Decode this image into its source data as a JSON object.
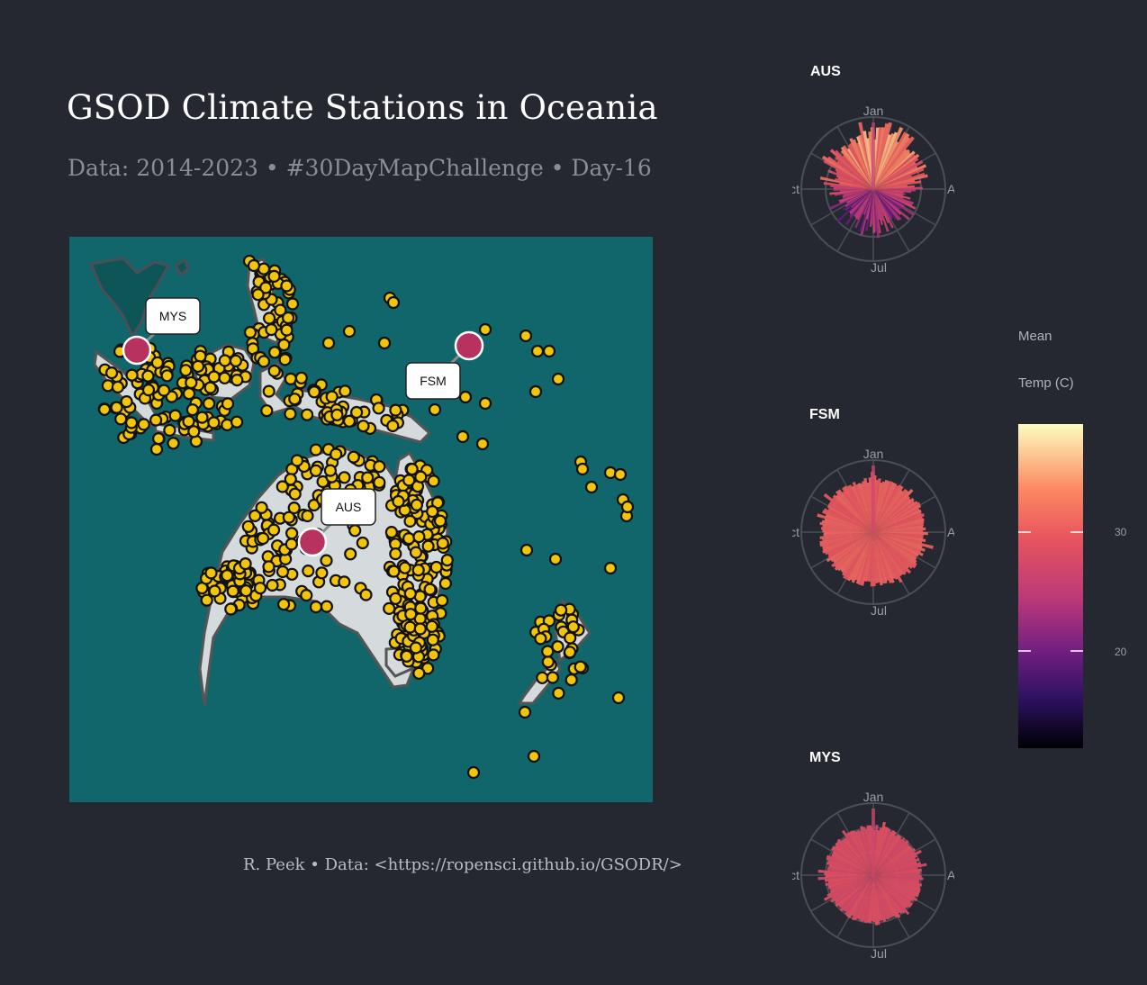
{
  "title": "GSOD Climate Stations in Oceania",
  "subtitle": "Data: 2014-2023 • #30DayMapChallenge • Day-16",
  "caption": "R. Peek • Data: <https://ropensci.github.io/GSODR/>",
  "map": {
    "colors": {
      "ocean": "#10666a",
      "land": "#d5dbdc",
      "land_dark": "#0d5557",
      "coast": "#555555",
      "station": "#f2c40a",
      "station_edge": "#111111",
      "highlight": "#b8325f"
    },
    "labels": [
      {
        "code": "MYS"
      },
      {
        "code": "FSM"
      },
      {
        "code": "AUS"
      }
    ]
  },
  "polar_panels": [
    {
      "title": "AUS",
      "months": [
        "Jan",
        "Apr",
        "Jul",
        "Oct"
      ]
    },
    {
      "title": "FSM",
      "months": [
        "Jan",
        "Apr",
        "Jul",
        "Oct"
      ]
    },
    {
      "title": "MYS",
      "months": [
        "Jan",
        "Apr",
        "Jul",
        "Oct"
      ]
    }
  ],
  "legend": {
    "title_line1": "Mean",
    "title_line2": "Temp (C)",
    "ticks": [
      "30",
      "20"
    ],
    "palette": [
      "#fcfdbf",
      "#fc8961",
      "#e8555e",
      "#b73779",
      "#721f81",
      "#2c115f",
      "#000004"
    ]
  }
}
